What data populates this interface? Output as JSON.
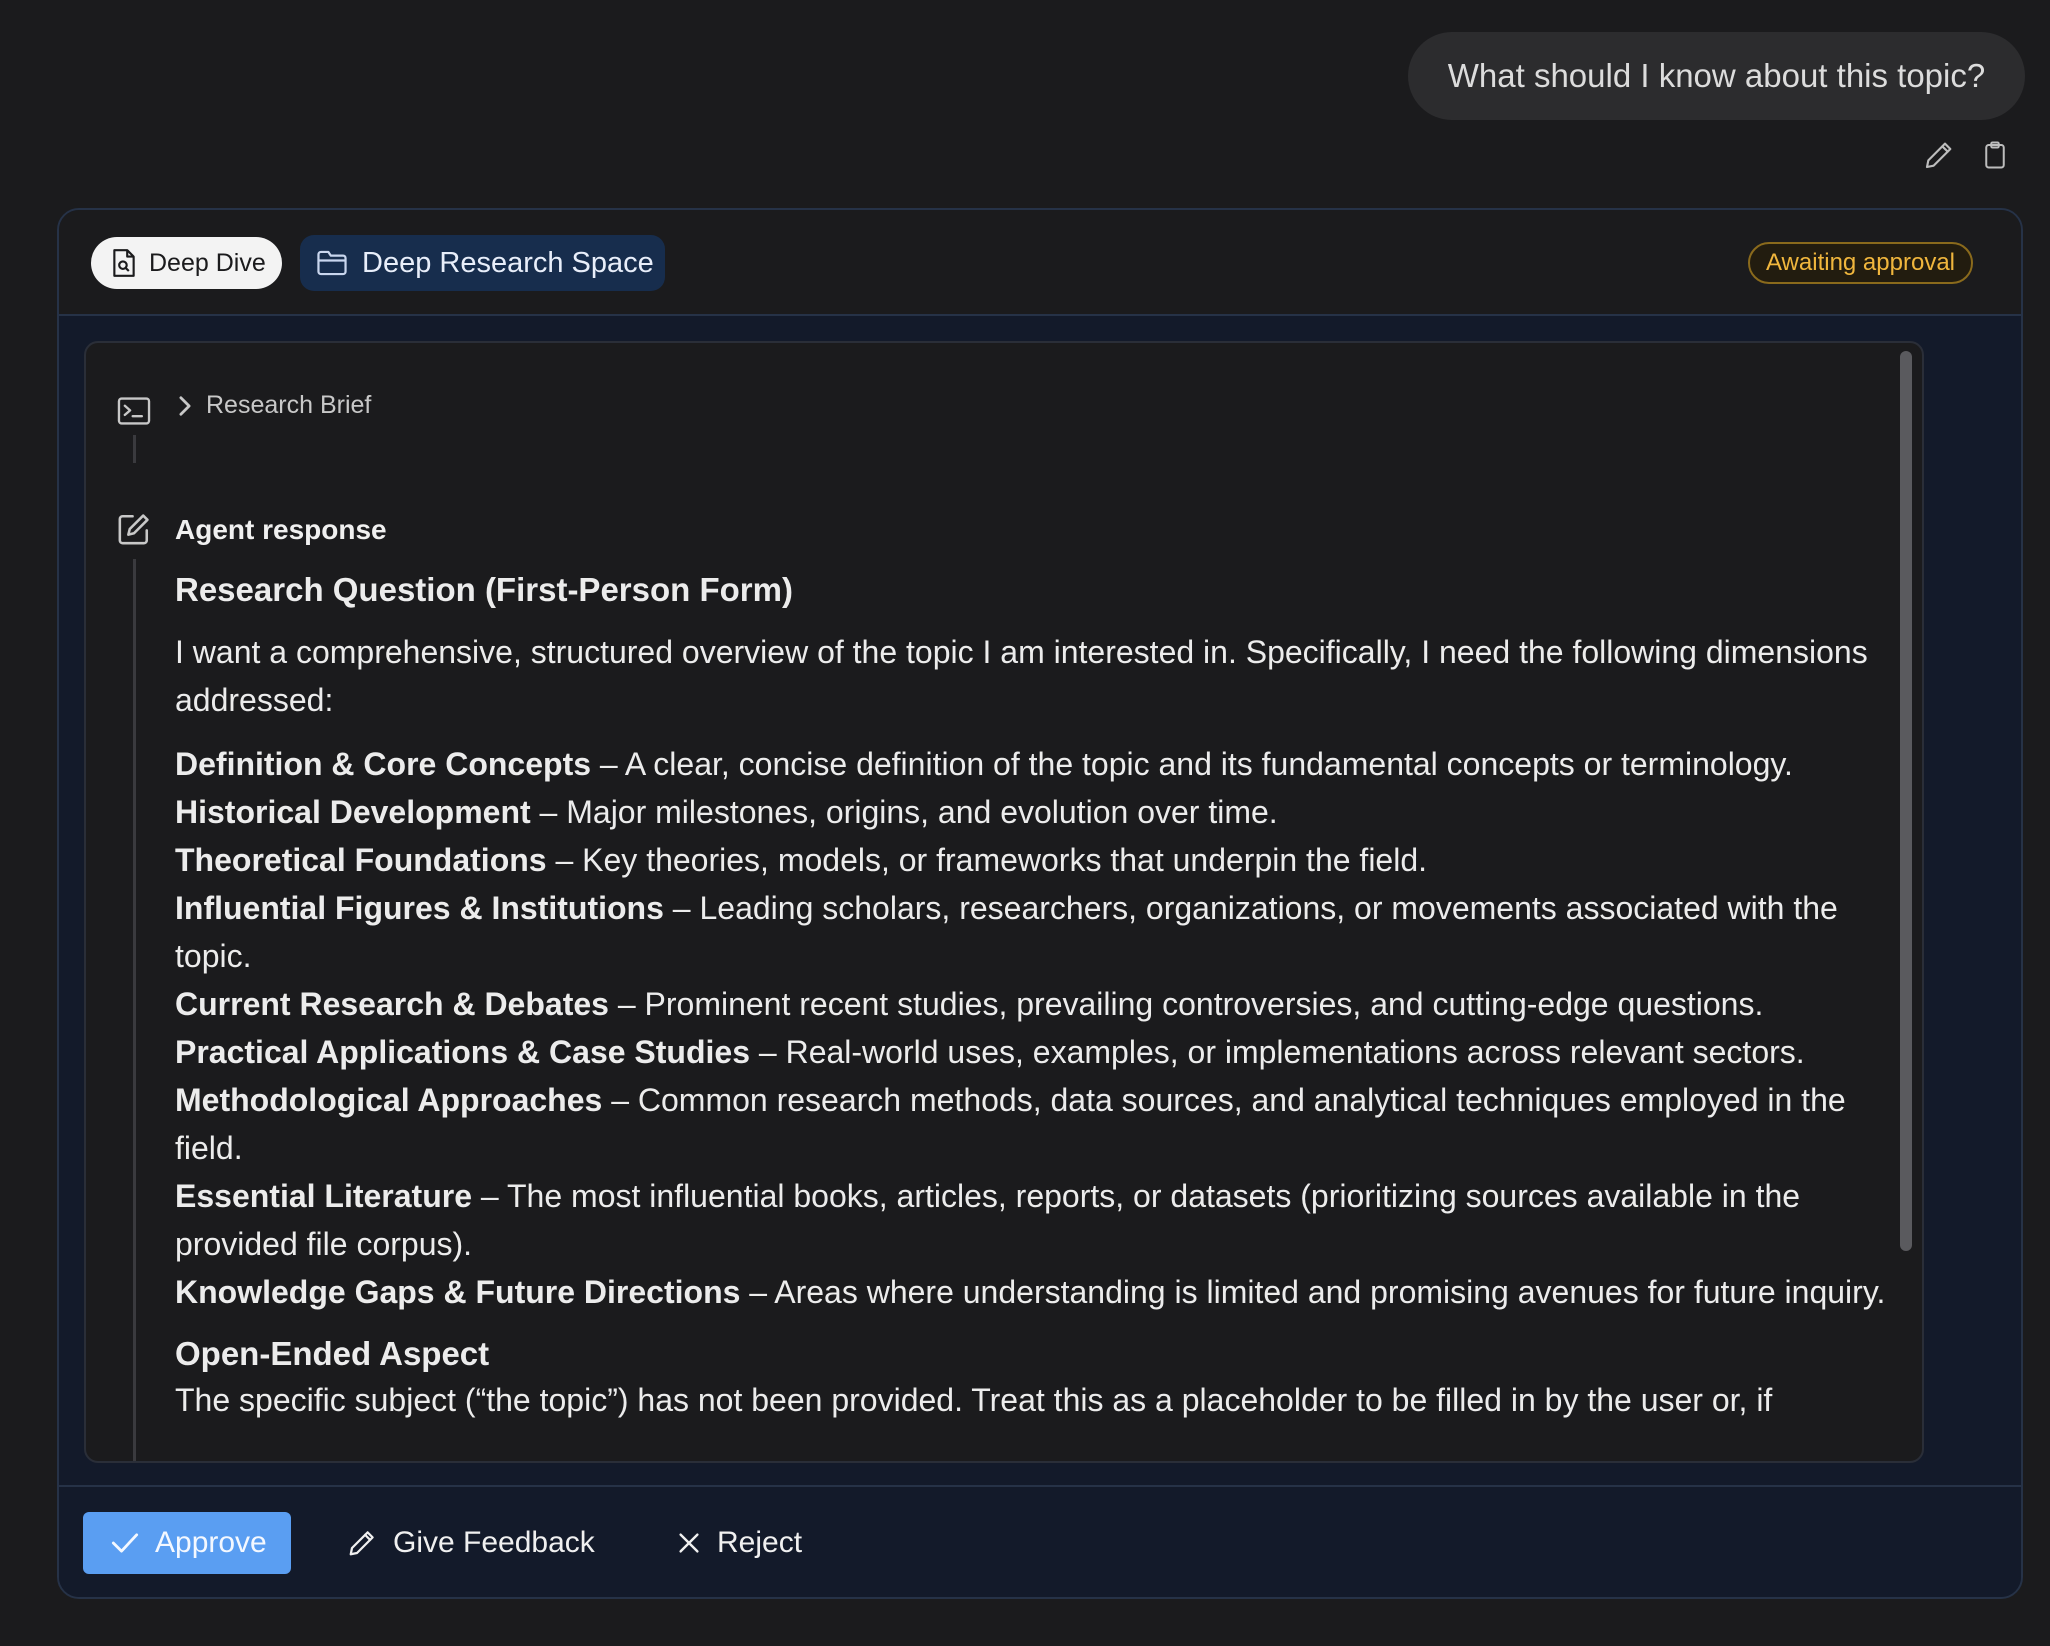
{
  "user_message": "What should I know about this topic?",
  "header": {
    "deep_dive_label": "Deep Dive",
    "space_label": "Deep Research Space",
    "status": "Awaiting approval"
  },
  "timeline": {
    "brief_label": "Research Brief",
    "agent_label": "Agent response"
  },
  "content": {
    "heading": "Research Question (First-Person Form)",
    "intro": "I want a comprehensive, structured overview of the topic I am interested in. Specifically, I need the following dimensions addressed:",
    "items": [
      {
        "title": "Definition & Core Concepts",
        "text": " – A clear, concise definition of the topic and its fundamental concepts or terminology."
      },
      {
        "title": "Historical Development",
        "text": " – Major milestones, origins, and evolution over time."
      },
      {
        "title": "Theoretical Foundations",
        "text": " – Key theories, models, or frameworks that underpin the field."
      },
      {
        "title": "Influential Figures & Institutions",
        "text": " – Leading scholars, researchers, organizations, or movements associated with the topic."
      },
      {
        "title": "Current Research & Debates",
        "text": " – Prominent recent studies, prevailing controversies, and cutting-edge questions."
      },
      {
        "title": "Practical Applications & Case Studies",
        "text": " – Real-world uses, examples, or implementations across relevant sectors."
      },
      {
        "title": "Methodological Approaches",
        "text": " – Common research methods, data sources, and analytical techniques employed in the field."
      },
      {
        "title": "Essential Literature",
        "text": " – The most influential books, articles, reports, or datasets (prioritizing sources available in the provided file corpus)."
      },
      {
        "title": "Knowledge Gaps & Future Directions",
        "text": " – Areas where understanding is limited and promising avenues for future inquiry."
      }
    ],
    "open_heading": "Open-Ended Aspect",
    "open_text": "The specific subject (“the topic”) has not been provided. Treat this as a placeholder to be filled in by the user or, if"
  },
  "footer": {
    "approve_label": "Approve",
    "feedback_label": "Give Feedback",
    "reject_label": "Reject"
  }
}
